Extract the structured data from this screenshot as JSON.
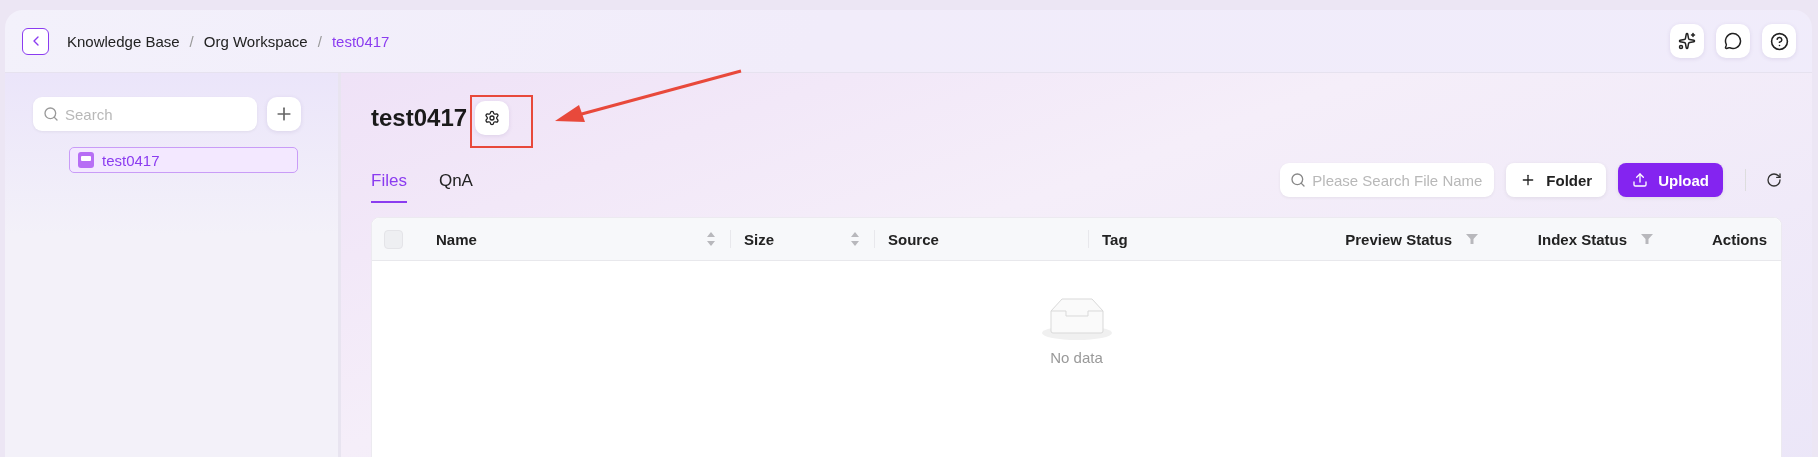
{
  "breadcrumb": [
    {
      "label": "Knowledge Base",
      "current": false
    },
    {
      "separator": "/",
      "label": "Org Workspace",
      "current": false
    },
    {
      "separator": "/",
      "label": "test0417",
      "current": true
    }
  ],
  "sidebar": {
    "search": {
      "placeholder": "Search"
    },
    "items": [
      {
        "label": "test0417",
        "selected": true
      }
    ]
  },
  "page_title": "test0417",
  "tabs": [
    {
      "label": "Files",
      "selected": true
    },
    {
      "label": "QnA",
      "selected": false
    }
  ],
  "file_search": {
    "placeholder": "Please Search File Name"
  },
  "buttons": [
    {
      "kind": "secondary",
      "label": "Folder"
    },
    {
      "kind": "primary",
      "label": "Upload"
    }
  ],
  "table": {
    "select_all": {
      "checked": false
    },
    "columns": [
      {
        "label": "Name",
        "kind": "sort"
      },
      {
        "label": "Size",
        "kind": "sort"
      },
      {
        "label": "Source",
        "kind": "plain"
      },
      {
        "label": "Tag",
        "kind": "plain"
      },
      {
        "label": "Preview Status",
        "kind": "filter"
      },
      {
        "label": "Index Status",
        "kind": "filter"
      },
      {
        "label": "Actions",
        "kind": "plain"
      }
    ],
    "empty_text": "No data"
  }
}
